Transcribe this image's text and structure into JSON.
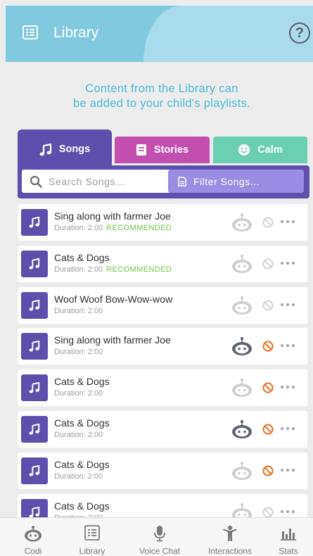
{
  "header": {
    "title": "Library",
    "help_label": "?"
  },
  "intro": {
    "line1": "Content from the Library can",
    "line2": "be added to your child's playlists."
  },
  "tabs": [
    {
      "label": "Songs",
      "icon": "music-note-icon",
      "color": "#5e4fad",
      "active": true
    },
    {
      "label": "Stories",
      "icon": "book-icon",
      "color": "#c24fb0",
      "active": false
    },
    {
      "label": "Calm",
      "icon": "smiley-icon",
      "color": "#6ccfb1",
      "active": false
    }
  ],
  "search": {
    "placeholder": "Search Songs...",
    "value": ""
  },
  "filter": {
    "label": "Filter Songs..."
  },
  "songs": [
    {
      "title": "Sing along with farmer Joe",
      "duration": "Duration: 2:00",
      "badge": "RECOMMENDED",
      "robot_active": false,
      "blocked": false
    },
    {
      "title": "Cats & Dogs",
      "duration": "Duration: 2:00",
      "badge": "RECOMMENDED",
      "robot_active": false,
      "blocked": false
    },
    {
      "title": "Woof Woof Bow-Wow-wow",
      "duration": "Duration: 2:00",
      "badge": "",
      "robot_active": false,
      "blocked": false
    },
    {
      "title": "Sing along with farmer Joe",
      "duration": "Duration: 2:00",
      "badge": "",
      "robot_active": true,
      "blocked": true
    },
    {
      "title": "Cats & Dogs",
      "duration": "Duration: 2:00",
      "badge": "",
      "robot_active": false,
      "blocked": true
    },
    {
      "title": "Cats & Dogs",
      "duration": "Duration: 2:00",
      "badge": "",
      "robot_active": true,
      "blocked": true
    },
    {
      "title": "Cats & Dogs",
      "duration": "Duration: 2:00",
      "badge": "",
      "robot_active": false,
      "blocked": true
    },
    {
      "title": "Cats & Dogs",
      "duration": "Duration: 2:00",
      "badge": "",
      "robot_active": false,
      "blocked": false
    }
  ],
  "nav": [
    {
      "label": "Codi",
      "icon": "robot-icon"
    },
    {
      "label": "Library",
      "icon": "library-icon"
    },
    {
      "label": "Voice Chat",
      "icon": "microphone-icon"
    },
    {
      "label": "Interactions",
      "icon": "person-icon"
    },
    {
      "label": "Stats",
      "icon": "bar-chart-icon"
    }
  ],
  "colors": {
    "header": "#80c9e0",
    "accent": "#5e4fad",
    "recommended": "#6dc34a",
    "blocked": "#f06a1c",
    "robot_active": "#5d6470",
    "robot_inactive": "#cfcfcf"
  }
}
